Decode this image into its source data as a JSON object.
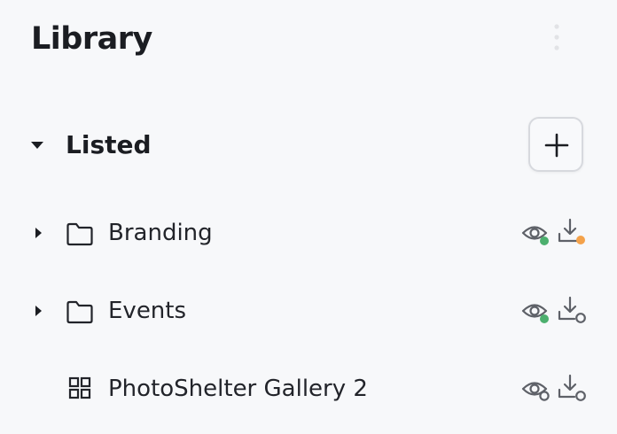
{
  "header": {
    "title": "Library",
    "menu_icon": "more-vertical-icon"
  },
  "section": {
    "label": "Listed",
    "expanded": true,
    "add_icon": "plus-icon"
  },
  "items": [
    {
      "label": "Branding",
      "type": "folder",
      "expandable": true,
      "visibility_status": "green",
      "download_status": "orange"
    },
    {
      "label": "Events",
      "type": "folder",
      "expandable": true,
      "visibility_status": "green",
      "download_status": "none"
    },
    {
      "label": "PhotoShelter Gallery 2",
      "type": "gallery",
      "expandable": false,
      "visibility_status": "none",
      "download_status": "none"
    }
  ],
  "colors": {
    "status_green": "#4caf6e",
    "status_orange": "#f4a24a",
    "icon_gray": "#5e6168",
    "background": "#f7f8fa"
  }
}
